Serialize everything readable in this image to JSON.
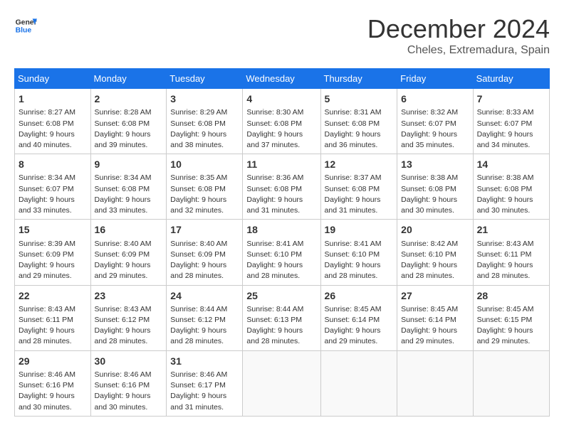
{
  "logo": {
    "line1": "General",
    "line2": "Blue"
  },
  "title": "December 2024",
  "location": "Cheles, Extremadura, Spain",
  "weekdays": [
    "Sunday",
    "Monday",
    "Tuesday",
    "Wednesday",
    "Thursday",
    "Friday",
    "Saturday"
  ],
  "weeks": [
    [
      {
        "day": "1",
        "sunrise": "8:27 AM",
        "sunset": "6:08 PM",
        "daylight": "9 hours and 40 minutes."
      },
      {
        "day": "2",
        "sunrise": "8:28 AM",
        "sunset": "6:08 PM",
        "daylight": "9 hours and 39 minutes."
      },
      {
        "day": "3",
        "sunrise": "8:29 AM",
        "sunset": "6:08 PM",
        "daylight": "9 hours and 38 minutes."
      },
      {
        "day": "4",
        "sunrise": "8:30 AM",
        "sunset": "6:08 PM",
        "daylight": "9 hours and 37 minutes."
      },
      {
        "day": "5",
        "sunrise": "8:31 AM",
        "sunset": "6:08 PM",
        "daylight": "9 hours and 36 minutes."
      },
      {
        "day": "6",
        "sunrise": "8:32 AM",
        "sunset": "6:07 PM",
        "daylight": "9 hours and 35 minutes."
      },
      {
        "day": "7",
        "sunrise": "8:33 AM",
        "sunset": "6:07 PM",
        "daylight": "9 hours and 34 minutes."
      }
    ],
    [
      {
        "day": "8",
        "sunrise": "8:34 AM",
        "sunset": "6:07 PM",
        "daylight": "9 hours and 33 minutes."
      },
      {
        "day": "9",
        "sunrise": "8:34 AM",
        "sunset": "6:08 PM",
        "daylight": "9 hours and 33 minutes."
      },
      {
        "day": "10",
        "sunrise": "8:35 AM",
        "sunset": "6:08 PM",
        "daylight": "9 hours and 32 minutes."
      },
      {
        "day": "11",
        "sunrise": "8:36 AM",
        "sunset": "6:08 PM",
        "daylight": "9 hours and 31 minutes."
      },
      {
        "day": "12",
        "sunrise": "8:37 AM",
        "sunset": "6:08 PM",
        "daylight": "9 hours and 31 minutes."
      },
      {
        "day": "13",
        "sunrise": "8:38 AM",
        "sunset": "6:08 PM",
        "daylight": "9 hours and 30 minutes."
      },
      {
        "day": "14",
        "sunrise": "8:38 AM",
        "sunset": "6:08 PM",
        "daylight": "9 hours and 30 minutes."
      }
    ],
    [
      {
        "day": "15",
        "sunrise": "8:39 AM",
        "sunset": "6:09 PM",
        "daylight": "9 hours and 29 minutes."
      },
      {
        "day": "16",
        "sunrise": "8:40 AM",
        "sunset": "6:09 PM",
        "daylight": "9 hours and 29 minutes."
      },
      {
        "day": "17",
        "sunrise": "8:40 AM",
        "sunset": "6:09 PM",
        "daylight": "9 hours and 28 minutes."
      },
      {
        "day": "18",
        "sunrise": "8:41 AM",
        "sunset": "6:10 PM",
        "daylight": "9 hours and 28 minutes."
      },
      {
        "day": "19",
        "sunrise": "8:41 AM",
        "sunset": "6:10 PM",
        "daylight": "9 hours and 28 minutes."
      },
      {
        "day": "20",
        "sunrise": "8:42 AM",
        "sunset": "6:10 PM",
        "daylight": "9 hours and 28 minutes."
      },
      {
        "day": "21",
        "sunrise": "8:43 AM",
        "sunset": "6:11 PM",
        "daylight": "9 hours and 28 minutes."
      }
    ],
    [
      {
        "day": "22",
        "sunrise": "8:43 AM",
        "sunset": "6:11 PM",
        "daylight": "9 hours and 28 minutes."
      },
      {
        "day": "23",
        "sunrise": "8:43 AM",
        "sunset": "6:12 PM",
        "daylight": "9 hours and 28 minutes."
      },
      {
        "day": "24",
        "sunrise": "8:44 AM",
        "sunset": "6:12 PM",
        "daylight": "9 hours and 28 minutes."
      },
      {
        "day": "25",
        "sunrise": "8:44 AM",
        "sunset": "6:13 PM",
        "daylight": "9 hours and 28 minutes."
      },
      {
        "day": "26",
        "sunrise": "8:45 AM",
        "sunset": "6:14 PM",
        "daylight": "9 hours and 29 minutes."
      },
      {
        "day": "27",
        "sunrise": "8:45 AM",
        "sunset": "6:14 PM",
        "daylight": "9 hours and 29 minutes."
      },
      {
        "day": "28",
        "sunrise": "8:45 AM",
        "sunset": "6:15 PM",
        "daylight": "9 hours and 29 minutes."
      }
    ],
    [
      {
        "day": "29",
        "sunrise": "8:46 AM",
        "sunset": "6:16 PM",
        "daylight": "9 hours and 30 minutes."
      },
      {
        "day": "30",
        "sunrise": "8:46 AM",
        "sunset": "6:16 PM",
        "daylight": "9 hours and 30 minutes."
      },
      {
        "day": "31",
        "sunrise": "8:46 AM",
        "sunset": "6:17 PM",
        "daylight": "9 hours and 31 minutes."
      },
      null,
      null,
      null,
      null
    ]
  ]
}
